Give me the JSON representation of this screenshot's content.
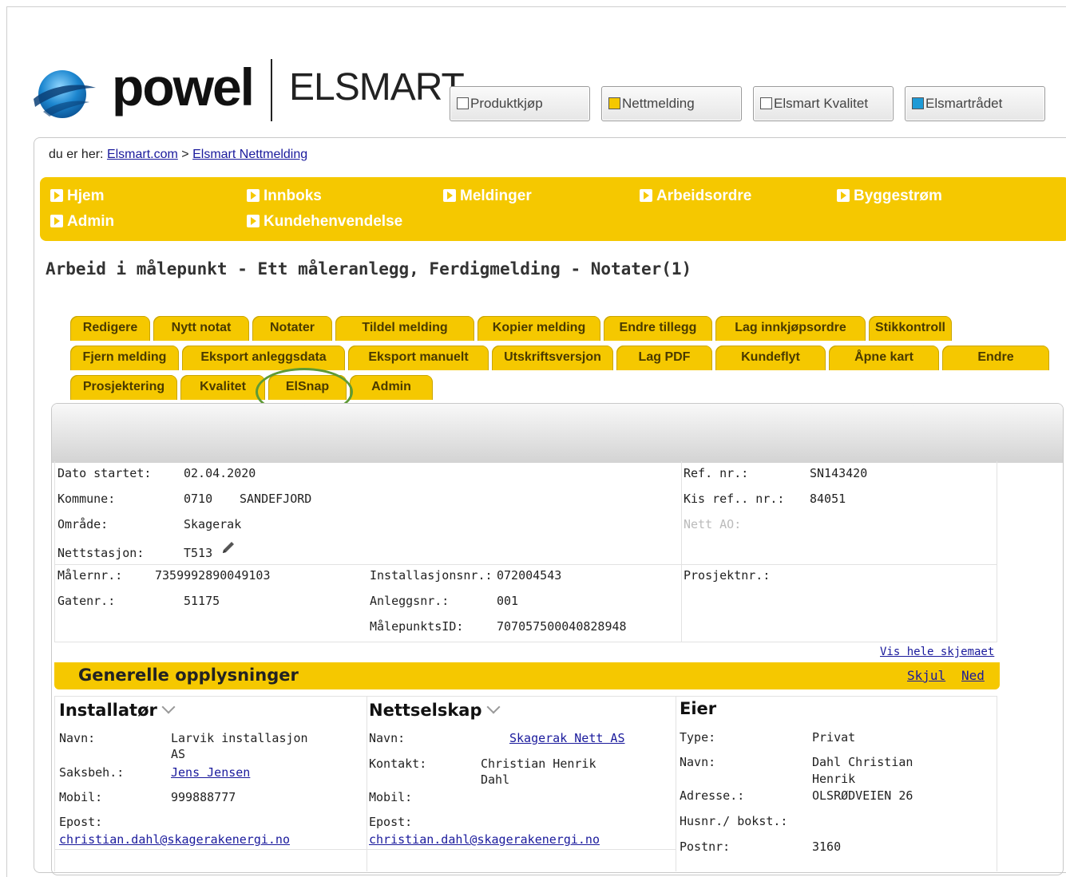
{
  "brand": {
    "logo_word": "powel",
    "product": "ELSMART"
  },
  "product_buttons": [
    {
      "label": "Produktkjøp",
      "color": "#ffffff"
    },
    {
      "label": "Nettmelding",
      "color": "#f5c800"
    },
    {
      "label": "Elsmart Kvalitet",
      "color": "#ffffff"
    },
    {
      "label": "Elsmartrådet",
      "color": "#1e9ad6"
    }
  ],
  "breadcrumb": {
    "prefix": "du er her:",
    "home": "Elsmart.com",
    "sep": ">",
    "current": "Elsmart Nettmelding"
  },
  "nav": [
    "Hjem",
    "Innboks",
    "Meldinger",
    "Arbeidsordre",
    "Byggestrøm",
    "Admin",
    "Kundehenvendelse"
  ],
  "page_title": "Arbeid i målepunkt - Ett måleranlegg, Ferdigmelding - Notater(1)",
  "tabs": {
    "row1": [
      "Redigere",
      "Nytt notat",
      "Notater",
      "Tildel melding",
      "Kopier melding",
      "Endre tillegg",
      "Lag innkjøpsordre",
      "Stikkontroll"
    ],
    "row2": [
      "Fjern melding",
      "Eksport anleggsdata",
      "Eksport manuelt",
      "Utskriftsversjon",
      "Lag PDF",
      "Kundeflyt",
      "Åpne kart",
      "Endre"
    ],
    "row3": [
      "Prosjektering",
      "Kvalitet",
      "ElSnap",
      "Admin"
    ]
  },
  "info": {
    "dato_label": "Dato startet:",
    "dato": "02.04.2020",
    "kommune_label": "Kommune:",
    "kommune_nr": "0710",
    "kommune": "SANDEFJORD",
    "omrade_label": "Område:",
    "omrade": "Skagerak",
    "nettstasjon_label": "Nettstasjon:",
    "nettstasjon": "T513",
    "ref_label": "Ref. nr.:",
    "ref": "SN143420",
    "kis_label": "Kis ref.. nr.:",
    "kis": "84051",
    "nettao_label": "Nett AO:",
    "malernr_label": "Målernr.:",
    "malernr": "7359992890049103",
    "gatenr_label": "Gatenr.:",
    "gatenr": "51175",
    "inst_label": "Installasjonsnr.:",
    "inst": "072004543",
    "anlegg_label": "Anleggsnr.:",
    "anlegg": "001",
    "malepunkt_label": "MålepunktsID:",
    "malepunkt": "707057500040828948",
    "prosjekt_label": "Prosjektnr.:"
  },
  "vis_hele": "Vis hele skjemaet",
  "section": {
    "title": "Generelle opplysninger",
    "hide": "Skjul",
    "down": "Ned"
  },
  "installator": {
    "heading": "Installatør",
    "navn_label": "Navn:",
    "navn_1": "Larvik installasjon",
    "navn_2": "AS",
    "saksbeh_label": "Saksbeh.:",
    "saksbeh": "Jens Jensen",
    "mobil_label": "Mobil:",
    "mobil": "999888777",
    "epost_label": "Epost:",
    "epost": "christian.dahl@skagerakenergi.no"
  },
  "nettselskap": {
    "heading": "Nettselskap",
    "navn_label": "Navn:",
    "navn": "Skagerak Nett AS",
    "kontakt_label": "Kontakt:",
    "kontakt_1": "Christian Henrik",
    "kontakt_2": "Dahl",
    "mobil_label": "Mobil:",
    "epost_label": "Epost:",
    "epost": "christian.dahl@skagerakenergi.no"
  },
  "eier": {
    "heading": "Eier",
    "type_label": "Type:",
    "type": "Privat",
    "navn_label": "Navn:",
    "navn_1": "Dahl Christian",
    "navn_2": "Henrik",
    "adresse_label": "Adresse.:",
    "adresse": "OLSRØDVEIEN 26",
    "husnr_label": "Husnr./ bokst.:",
    "postnr_label": "Postnr:",
    "postnr": "3160"
  }
}
